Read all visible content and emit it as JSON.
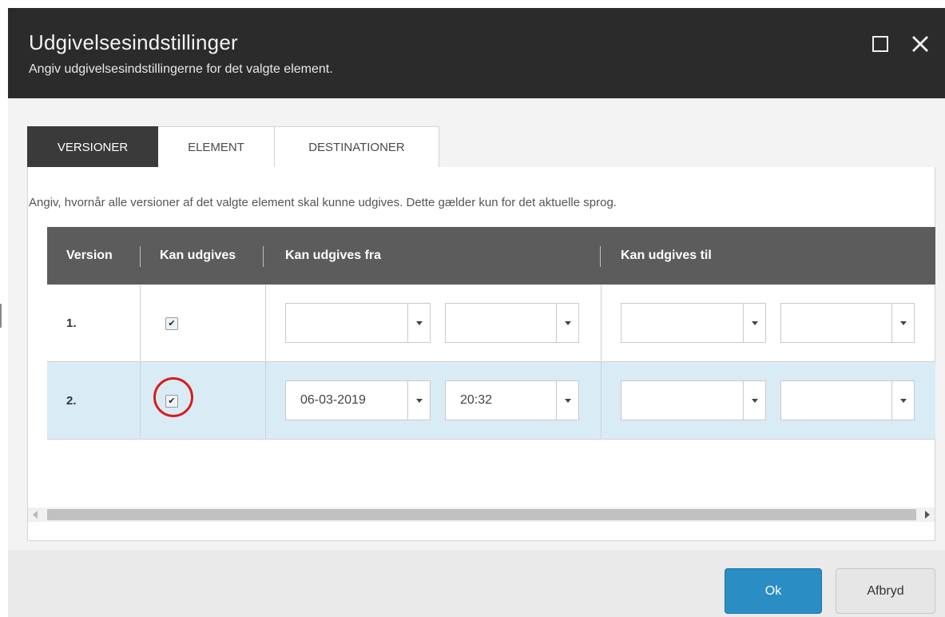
{
  "dialog": {
    "title": "Udgivelsesindstillinger",
    "subtitle": "Angiv udgivelsesindstillingerne for det valgte element.",
    "maximize_icon": "maximize-icon",
    "close_icon": "close-icon",
    "close_glyph": "✕"
  },
  "tabs": [
    {
      "label": "VERSIONER",
      "active": true
    },
    {
      "label": "ELEMENT",
      "active": false
    },
    {
      "label": "DESTINATIONER",
      "active": false
    }
  ],
  "description": "Angiv, hvornår alle versioner af det valgte element skal kunne udgives. Dette gælder kun for det aktuelle sprog.",
  "table": {
    "headers": [
      "Version",
      "Kan udgives",
      "Kan udgives fra",
      "Kan udgives til"
    ],
    "rows": [
      {
        "version": "1.",
        "publishable": true,
        "check_glyph": "✔",
        "from_date": "",
        "from_time": "",
        "to_date": "",
        "to_time": "",
        "selected": false
      },
      {
        "version": "2.",
        "publishable": true,
        "check_glyph": "✔",
        "from_date": "06-03-2019",
        "from_time": "20:32",
        "to_date": "",
        "to_time": "",
        "selected": true,
        "highlighted_checkbox": true
      }
    ]
  },
  "footer": {
    "ok_label": "Ok",
    "cancel_label": "Afbryd"
  },
  "colors": {
    "header_bg": "#2b2b2b",
    "accent": "#2a8dc4",
    "selected_row": "#d9ecf6",
    "annotation": "#d61d1d"
  }
}
